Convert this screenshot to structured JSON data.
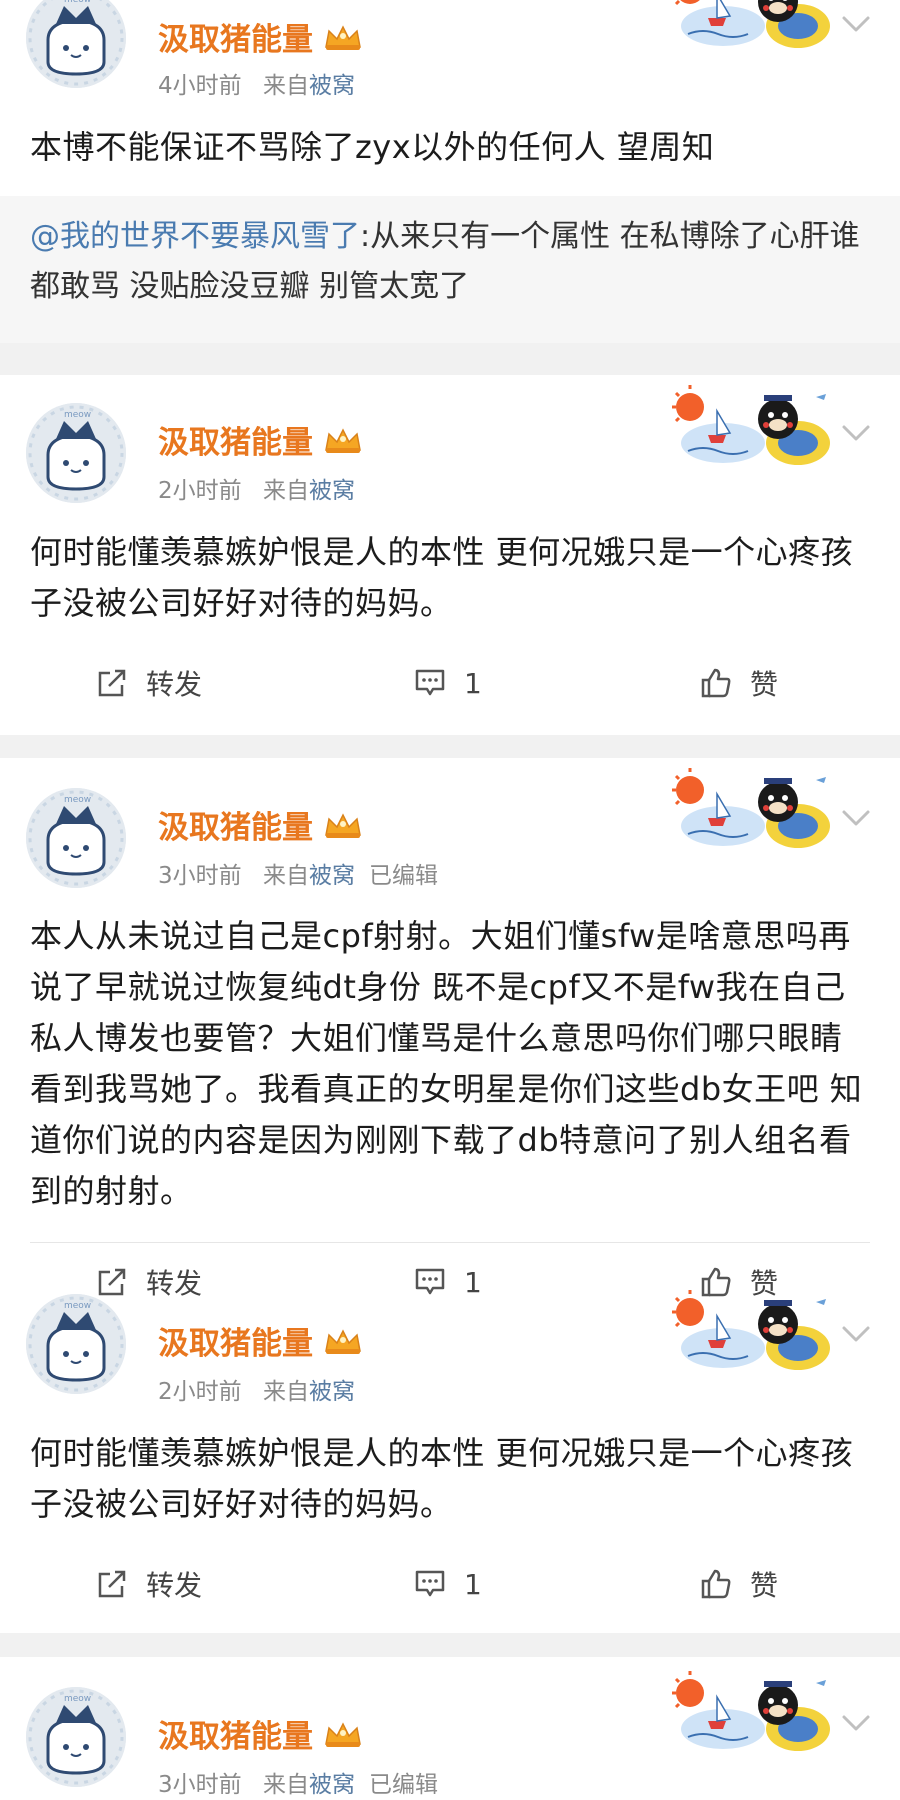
{
  "posts": [
    {
      "user": "汲取猪能量",
      "time": "4小时前",
      "from_label": "来自",
      "source": "被窝",
      "edited": "",
      "text": "本博不能保证不骂除了zyx以外的任何人 望周知",
      "quote": {
        "name": "@我的世界不要暴风雪了",
        "text": ":从来只有一个属性 在私博除了心肝谁都敢骂 没贴脸没豆瓣 别管太宽了"
      }
    },
    {
      "user": "汲取猪能量",
      "time": "2小时前",
      "from_label": "来自",
      "source": "被窝",
      "edited": "",
      "text": "何时能懂羡慕嫉妒恨是人的本性 更何况娥只是一个心疼孩子没被公司好好对待的妈妈。",
      "actions": {
        "repost": "转发",
        "comments": "1",
        "like": "赞"
      }
    },
    {
      "user": "汲取猪能量",
      "time": "3小时前",
      "from_label": "来自",
      "source": "被窝",
      "edited": "已编辑",
      "text": "本人从未说过自己是cpf射射。大姐们懂sfw是啥意思吗再说了早就说过恢复纯dt身份 既不是cpf又不是fw我在自己私人博发也要管？大姐们懂骂是什么意思吗你们哪只眼睛看到我骂她了。我看真正的女明星是你们这些db女王吧 知道你们说的内容是因为刚刚下载了db特意问了别人组名看到的射射。",
      "actions": {
        "repost": "转发",
        "comments": "1",
        "like": "赞"
      }
    },
    {
      "user": "汲取猪能量",
      "time": "2小时前",
      "from_label": "来自",
      "source": "被窝",
      "edited": "",
      "text": "何时能懂羡慕嫉妒恨是人的本性 更何况娥只是一个心疼孩子没被公司好好对待的妈妈。",
      "actions": {
        "repost": "转发",
        "comments": "1",
        "like": "赞"
      }
    },
    {
      "user": "汲取猪能量",
      "time": "3小时前",
      "from_label": "来自",
      "source": "被窝",
      "edited": "已编辑"
    }
  ],
  "colors": {
    "username": "#e8771f",
    "source_link": "#5a7da3",
    "quote_name": "#4a7bb0"
  },
  "icons": [
    "avatar",
    "vip-crown-icon",
    "sticker-decoration",
    "chevron-down-icon",
    "repost-icon",
    "comment-icon",
    "like-icon"
  ]
}
